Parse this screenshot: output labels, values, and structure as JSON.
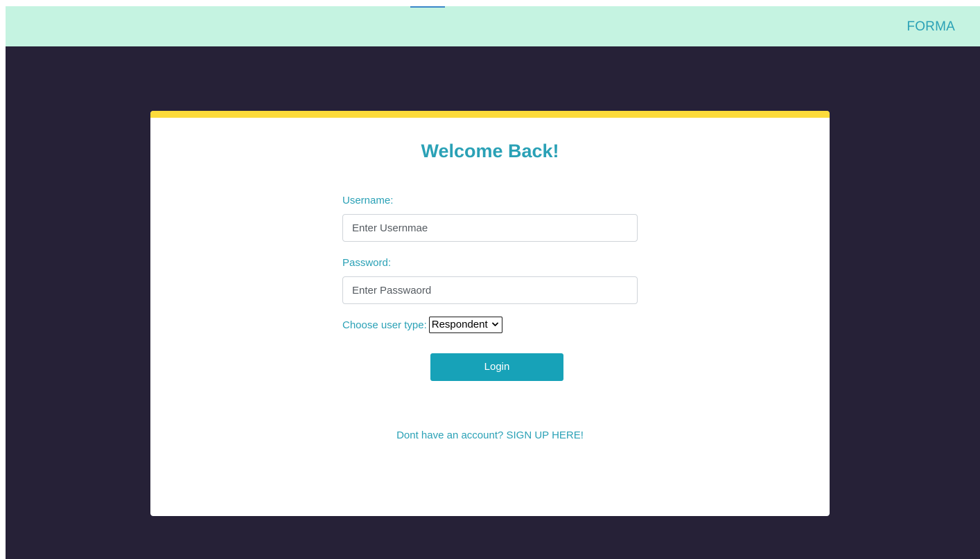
{
  "navbar": {
    "brand": "FORMA"
  },
  "login_card": {
    "title": "Welcome Back!",
    "username": {
      "label": "Username:",
      "placeholder": "Enter Usernmae",
      "value": ""
    },
    "password": {
      "label": "Password:",
      "placeholder": "Enter Passwaord",
      "value": ""
    },
    "user_type": {
      "label": "Choose user type:",
      "selected": "Respondent"
    },
    "login_label": "Login",
    "signup_text": "Dont have an account? SIGN UP HERE!"
  },
  "colors": {
    "page_background": "#262137",
    "navbar_background": "#c5f3e1",
    "accent_text": "#2aa1b6",
    "card_top_bar": "#fddb3a",
    "button_background": "#17a2b8"
  },
  "icons": {
    "select_indicator": "chevron-down-icon"
  }
}
